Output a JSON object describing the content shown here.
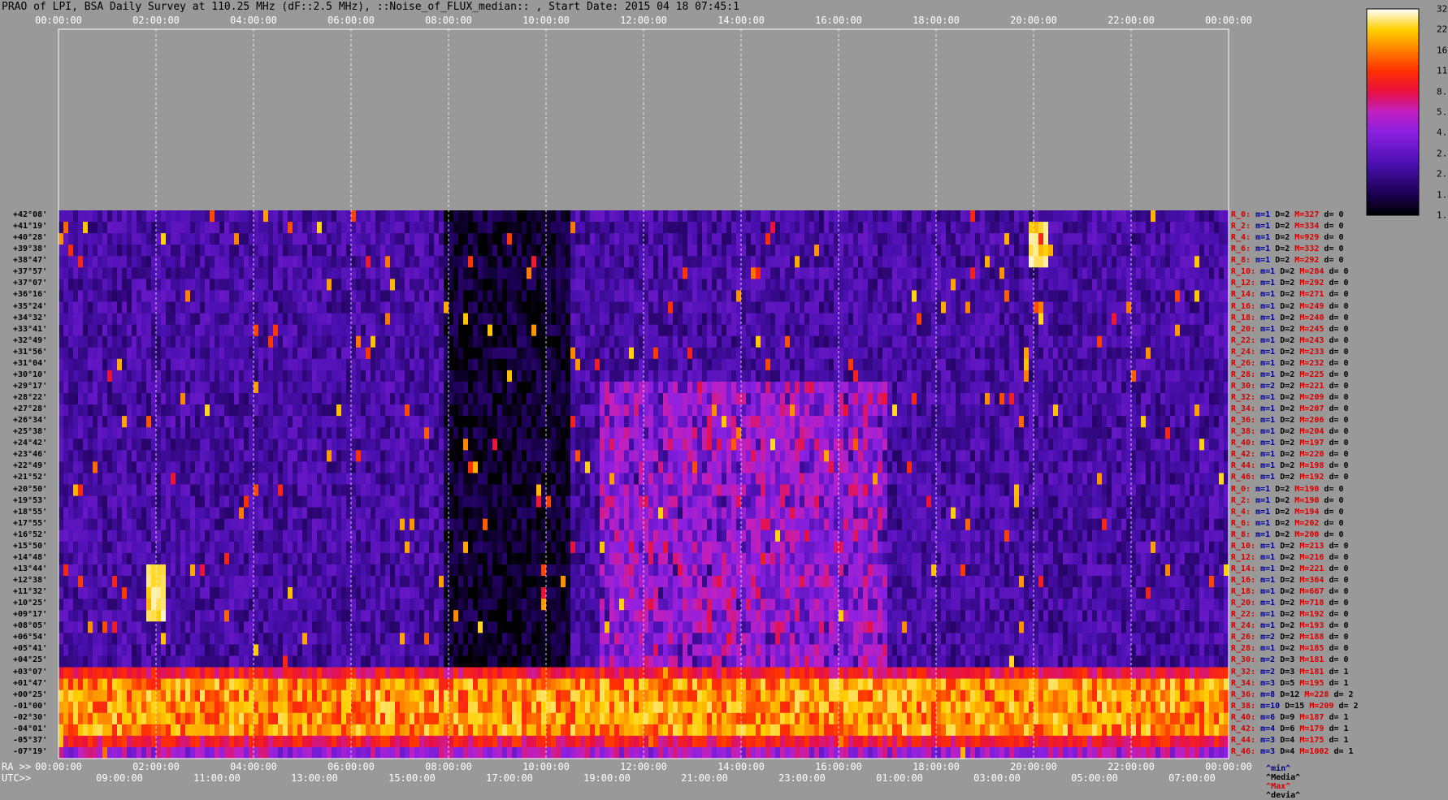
{
  "title": "PRAO of LPI, BSA Daily Survey at 110.25 MHz (dF::2.5 MHz), ::Noise_of_FLUX_median:: , Start Date: 2015 04 18 07:45:1",
  "top_ticks": [
    "00:00:00",
    "02:00:00",
    "04:00:00",
    "06:00:00",
    "08:00:00",
    "10:00:00",
    "12:00:00",
    "14:00:00",
    "16:00:00",
    "18:00:00",
    "20:00:00",
    "22:00:00",
    "00:00:00"
  ],
  "ra_label": "RA >>",
  "utc_label": "UTC>>",
  "ra_ticks": [
    "00:00:00",
    "02:00:00",
    "04:00:00",
    "06:00:00",
    "08:00:00",
    "10:00:00",
    "12:00:00",
    "14:00:00",
    "16:00:00",
    "18:00:00",
    "20:00:00",
    "22:00:00",
    "00:00:00"
  ],
  "utc_ticks": [
    "09:0",
    "0:00",
    "11:0",
    "0:00",
    "13:0",
    "0:00",
    "15:0",
    "0:00",
    "17:0",
    "0:00",
    "19:0",
    "0:00",
    "21:0",
    "0:00",
    "23:0",
    "0:00",
    "01:0",
    "0:00",
    "03:0",
    "0:00",
    "05:0",
    "0:00",
    "07:0",
    "0:00"
  ],
  "utc_ticks_full": [
    "09:00:00",
    "11:00:00",
    "13:00:00",
    "15:00:00",
    "17:00:00",
    "19:00:00",
    "21:00:00",
    "23:00:00",
    "01:00:00",
    "03:00:00",
    "05:00:00",
    "07:00:00"
  ],
  "declinations": [
    "+42°08'",
    "+41°19'",
    "+40°28'",
    "+39°38'",
    "+38°47'",
    "+37°57'",
    "+37°07'",
    "+36°16'",
    "+35°24'",
    "+34°32'",
    "+33°41'",
    "+32°49'",
    "+31°56'",
    "+31°04'",
    "+30°10'",
    "+29°17'",
    "+28°22'",
    "+27°28'",
    "+26°34'",
    "+25°38'",
    "+24°42'",
    "+23°46'",
    "+22°49'",
    "+21°52'",
    "+20°50'",
    "+19°53'",
    "+18°55'",
    "+17°55'",
    "+16°52'",
    "+15°50'",
    "+14°48'",
    "+13°44'",
    "+12°38'",
    "+11°32'",
    "+10°25'",
    "+09°17'",
    "+08°05'",
    "+06°54'",
    "+05°41'",
    "+04°25'",
    "+03°07'",
    "+01°47'",
    "+00°25'",
    "-01°00'",
    "-02°30'",
    "-04°01'",
    "-05°37'",
    "-07°19'"
  ],
  "stats": [
    {
      "r": "R_0:",
      "m": "m=1",
      "D": "D=2",
      "M": "M=327",
      "d": "d= 0"
    },
    {
      "r": "R_2:",
      "m": "m=1",
      "D": "D=2",
      "M": "M=334",
      "d": "d= 0"
    },
    {
      "r": "R_4:",
      "m": "m=1",
      "D": "D=2",
      "M": "M=929",
      "d": "d= 0"
    },
    {
      "r": "R_6:",
      "m": "m=1",
      "D": "D=2",
      "M": "M=332",
      "d": "d= 0"
    },
    {
      "r": "R_8:",
      "m": "m=1",
      "D": "D=2",
      "M": "M=292",
      "d": "d= 0"
    },
    {
      "r": "R_10:",
      "m": "m=1",
      "D": "D=2",
      "M": "M=284",
      "d": "d= 0"
    },
    {
      "r": "R_12:",
      "m": "m=1",
      "D": "D=2",
      "M": "M=292",
      "d": "d= 0"
    },
    {
      "r": "R_14:",
      "m": "m=1",
      "D": "D=2",
      "M": "M=271",
      "d": "d= 0"
    },
    {
      "r": "R_16:",
      "m": "m=1",
      "D": "D=2",
      "M": "M=249",
      "d": "d= 0"
    },
    {
      "r": "R_18:",
      "m": "m=1",
      "D": "D=2",
      "M": "M=240",
      "d": "d= 0"
    },
    {
      "r": "R_20:",
      "m": "m=1",
      "D": "D=2",
      "M": "M=245",
      "d": "d= 0"
    },
    {
      "r": "R_22:",
      "m": "m=1",
      "D": "D=2",
      "M": "M=243",
      "d": "d= 0"
    },
    {
      "r": "R_24:",
      "m": "m=1",
      "D": "D=2",
      "M": "M=233",
      "d": "d= 0"
    },
    {
      "r": "R_26:",
      "m": "m=1",
      "D": "D=2",
      "M": "M=232",
      "d": "d= 0"
    },
    {
      "r": "R_28:",
      "m": "m=1",
      "D": "D=2",
      "M": "M=225",
      "d": "d= 0"
    },
    {
      "r": "R_30:",
      "m": "m=2",
      "D": "D=2",
      "M": "M=221",
      "d": "d= 0"
    },
    {
      "r": "R_32:",
      "m": "m=1",
      "D": "D=2",
      "M": "M=209",
      "d": "d= 0"
    },
    {
      "r": "R_34:",
      "m": "m=1",
      "D": "D=2",
      "M": "M=207",
      "d": "d= 0"
    },
    {
      "r": "R_36:",
      "m": "m=1",
      "D": "D=2",
      "M": "M=206",
      "d": "d= 0"
    },
    {
      "r": "R_38:",
      "m": "m=1",
      "D": "D=2",
      "M": "M=204",
      "d": "d= 0"
    },
    {
      "r": "R_40:",
      "m": "m=1",
      "D": "D=2",
      "M": "M=197",
      "d": "d= 0"
    },
    {
      "r": "R_42:",
      "m": "m=1",
      "D": "D=2",
      "M": "M=220",
      "d": "d= 0"
    },
    {
      "r": "R_44:",
      "m": "m=1",
      "D": "D=2",
      "M": "M=198",
      "d": "d= 0"
    },
    {
      "r": "R_46:",
      "m": "m=1",
      "D": "D=2",
      "M": "M=192",
      "d": "d= 0"
    },
    {
      "r": "R_0:",
      "m": "m=1",
      "D": "D=2",
      "M": "M=190",
      "d": "d= 0"
    },
    {
      "r": "R_2:",
      "m": "m=1",
      "D": "D=2",
      "M": "M=190",
      "d": "d= 0"
    },
    {
      "r": "R_4:",
      "m": "m=1",
      "D": "D=2",
      "M": "M=194",
      "d": "d= 0"
    },
    {
      "r": "R_6:",
      "m": "m=1",
      "D": "D=2",
      "M": "M=202",
      "d": "d= 0"
    },
    {
      "r": "R_8:",
      "m": "m=1",
      "D": "D=2",
      "M": "M=200",
      "d": "d= 0"
    },
    {
      "r": "R_10:",
      "m": "m=1",
      "D": "D=2",
      "M": "M=213",
      "d": "d= 0"
    },
    {
      "r": "R_12:",
      "m": "m=1",
      "D": "D=2",
      "M": "M=216",
      "d": "d= 0"
    },
    {
      "r": "R_14:",
      "m": "m=1",
      "D": "D=2",
      "M": "M=221",
      "d": "d= 0"
    },
    {
      "r": "R_16:",
      "m": "m=1",
      "D": "D=2",
      "M": "M=364",
      "d": "d= 0"
    },
    {
      "r": "R_18:",
      "m": "m=1",
      "D": "D=2",
      "M": "M=667",
      "d": "d= 0"
    },
    {
      "r": "R_20:",
      "m": "m=1",
      "D": "D=2",
      "M": "M=718",
      "d": "d= 0"
    },
    {
      "r": "R_22:",
      "m": "m=1",
      "D": "D=2",
      "M": "M=192",
      "d": "d= 0"
    },
    {
      "r": "R_24:",
      "m": "m=1",
      "D": "D=2",
      "M": "M=193",
      "d": "d= 0"
    },
    {
      "r": "R_26:",
      "m": "m=2",
      "D": "D=2",
      "M": "M=188",
      "d": "d= 0"
    },
    {
      "r": "R_28:",
      "m": "m=1",
      "D": "D=2",
      "M": "M=185",
      "d": "d= 0"
    },
    {
      "r": "R_30:",
      "m": "m=2",
      "D": "D=3",
      "M": "M=181",
      "d": "d= 0"
    },
    {
      "r": "R_32:",
      "m": "m=2",
      "D": "D=3",
      "M": "M=181",
      "d": "d= 1"
    },
    {
      "r": "R_34:",
      "m": "m=3",
      "D": "D=5",
      "M": "M=195",
      "d": "d= 1"
    },
    {
      "r": "R_36:",
      "m": "m=8",
      "D": "D=12",
      "M": "M=228",
      "d": "d= 2"
    },
    {
      "r": "R_38:",
      "m": "m=10",
      "D": "D=15",
      "M": "M=209",
      "d": "d= 2"
    },
    {
      "r": "R_40:",
      "m": "m=6",
      "D": "D=9",
      "M": "M=187",
      "d": "d= 1"
    },
    {
      "r": "R_42:",
      "m": "m=4",
      "D": "D=6",
      "M": "M=179",
      "d": "d= 1"
    },
    {
      "r": "R_44:",
      "m": "m=3",
      "D": "D=4",
      "M": "M=175",
      "d": "d= 1"
    },
    {
      "r": "R_46:",
      "m": "m=3",
      "D": "D=4",
      "M": "M=1002",
      "d": "d= 1"
    }
  ],
  "stats_legend": {
    "min": "^min^",
    "median": "^Media^",
    "max": "^Max^",
    "dev": "^devia^"
  },
  "colorbar_labels": [
    "32.0",
    "22.6",
    "16.0",
    "11.3",
    "8.0",
    "5.7",
    "4.0",
    "2.8",
    "2.0",
    "1.4",
    "1.0"
  ],
  "colors": {
    "background": "#999999",
    "dark": "#0a0020",
    "purple": "#6a1fd0",
    "red": "#e81010",
    "yellow": "#ffe040",
    "white": "#ffffff"
  },
  "chart_data": {
    "type": "heatmap",
    "title": "PRAO of LPI, BSA Daily Survey at 110.25 MHz (dF::2.5 MHz), ::Noise_of_FLUX_median:: , Start Date: 2015 04 18 07:45:1",
    "x_axis_top": "Sidereal time 00:00:00 to 00:00:00",
    "x_axis_bottom_ra": [
      "00:00:00",
      "02:00:00",
      "04:00:00",
      "06:00:00",
      "08:00:00",
      "10:00:00",
      "12:00:00",
      "14:00:00",
      "16:00:00",
      "18:00:00",
      "20:00:00",
      "22:00:00",
      "00:00:00"
    ],
    "x_axis_bottom_utc": [
      "09:00:00",
      "11:00:00",
      "13:00:00",
      "15:00:00",
      "17:00:00",
      "19:00:00",
      "21:00:00",
      "23:00:00",
      "01:00:00",
      "03:00:00",
      "05:00:00",
      "07:00:00"
    ],
    "y_axis": "Declination beams, +42°08' (top) to -07°19' (bottom), 48 beams",
    "colorbar_range": [
      1.0,
      32.0
    ],
    "colorbar_scale": "log2",
    "features": [
      {
        "desc": "bright horizontal band near beams +01°47' to -04°01'",
        "value_level": "high"
      },
      {
        "desc": "bright compact source near 02:00 RA, +11°32'",
        "value_level": "high"
      },
      {
        "desc": "bright compact source near 20:00 RA, +40°28'",
        "value_level": "high"
      },
      {
        "desc": "dark low-noise region around 08:00-10:00 RA",
        "value_level": "low"
      }
    ]
  }
}
